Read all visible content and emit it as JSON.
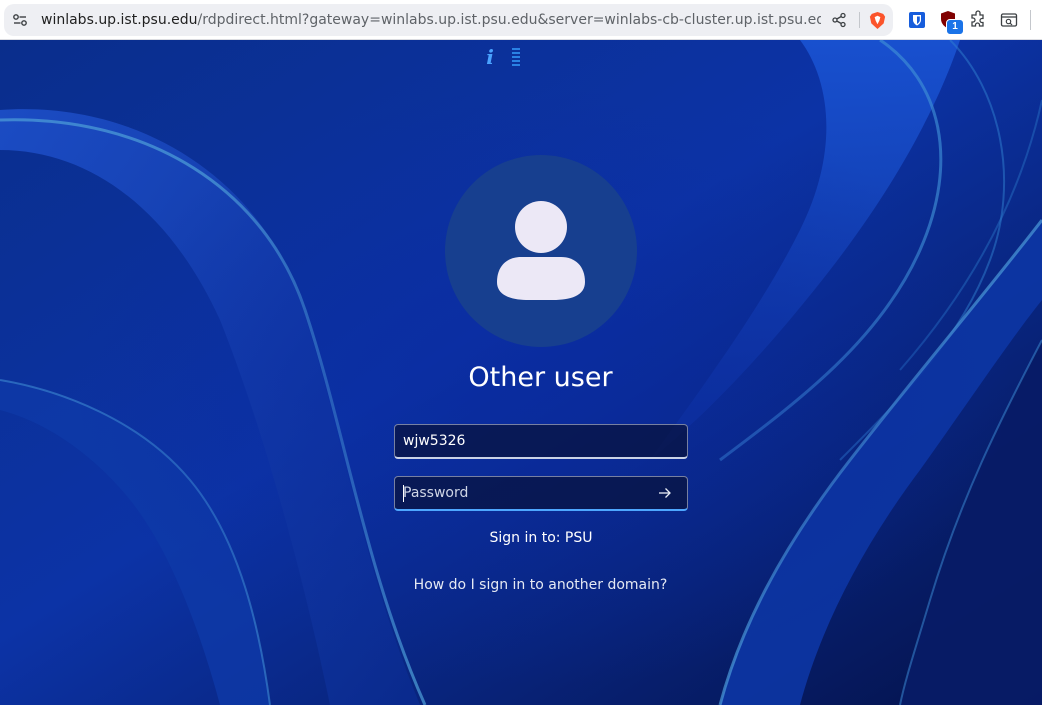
{
  "browser": {
    "url_host": "winlabs.up.ist.psu.edu",
    "url_path": "/rdpdirect.html?gateway=winlabs.up.ist.psu.edu&server=winlabs-cb-cluster.up.ist.psu.edu&...",
    "extension_badge": "1",
    "icons": [
      "site-info-icon",
      "share-icon",
      "brave-shields-icon",
      "bitwarden-icon",
      "ublock-icon",
      "extensions-icon",
      "screenshot-icon"
    ]
  },
  "rdp": {
    "info_glyph": "i"
  },
  "login": {
    "title": "Other user",
    "username_value": "wjw5326",
    "password_placeholder": "Password",
    "sign_in_to": "Sign in to: PSU",
    "other_domain_link": "How do I sign in to another domain?"
  },
  "colors": {
    "wallpaper_base": "#0b2d8a",
    "avatar_bg": "#173f8f",
    "focus_accent": "#4ea7ff"
  }
}
